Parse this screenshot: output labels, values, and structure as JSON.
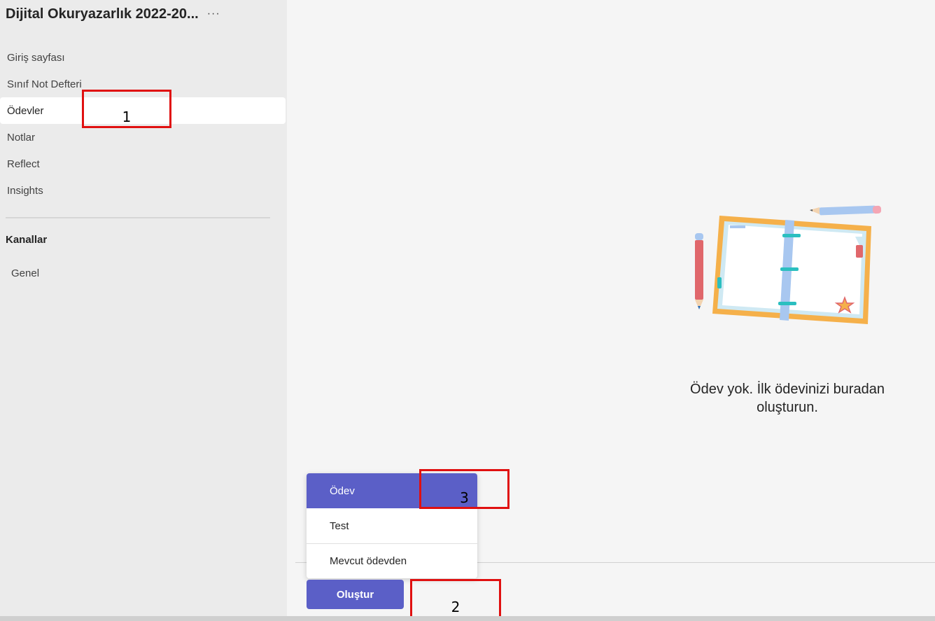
{
  "sidebar": {
    "team_name": "Dijital Okuryazarlık 2022-20...",
    "more_icon": "···",
    "items": [
      {
        "label": "Giriş sayfası"
      },
      {
        "label": "Sınıf Not Defteri"
      },
      {
        "label": "Ödevler"
      },
      {
        "label": "Notlar"
      },
      {
        "label": "Reflect"
      },
      {
        "label": "Insights"
      }
    ],
    "channels_heading": "Kanallar",
    "channels": [
      {
        "label": "Genel"
      }
    ]
  },
  "main": {
    "empty_message_line1": "Ödev yok. İlk ödevinizi buradan",
    "empty_message_line2": "oluşturun."
  },
  "create_menu": {
    "items": [
      {
        "label": "Ödev"
      },
      {
        "label": "Test"
      },
      {
        "label": "Mevcut ödevden"
      }
    ],
    "create_button": "Oluştur"
  },
  "callouts": [
    {
      "label": "1"
    },
    {
      "label": "2"
    },
    {
      "label": "3"
    }
  ],
  "colors": {
    "accent": "#5b5fc7",
    "callout_border": "#e01010"
  }
}
